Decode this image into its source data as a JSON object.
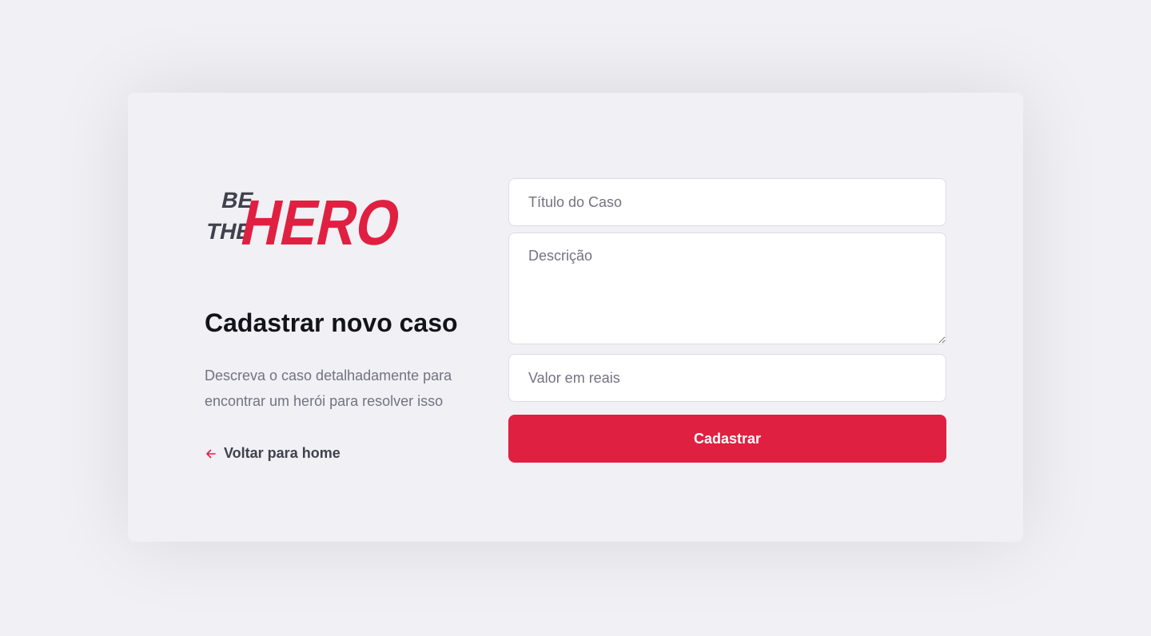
{
  "colors": {
    "background": "#f0f0f5",
    "brand": "#e02041",
    "logo_dark": "#41414d",
    "heading": "#13131a",
    "muted_text": "#737380",
    "input_border": "#dcdce6"
  },
  "logo": {
    "small_line_1": "BE",
    "small_line_2": "THE",
    "big_word": "HERO"
  },
  "page": {
    "title": "Cadastrar novo caso",
    "description": "Descreva o caso detalhadamente para encontrar um herói para resolver isso",
    "back_link": {
      "icon": "arrow-left-icon",
      "label": "Voltar para home"
    }
  },
  "form": {
    "title_field": {
      "placeholder": "Título do Caso",
      "value": ""
    },
    "description_field": {
      "placeholder": "Descrição",
      "value": ""
    },
    "value_field": {
      "placeholder": "Valor em reais",
      "value": ""
    },
    "submit_label": "Cadastrar"
  }
}
